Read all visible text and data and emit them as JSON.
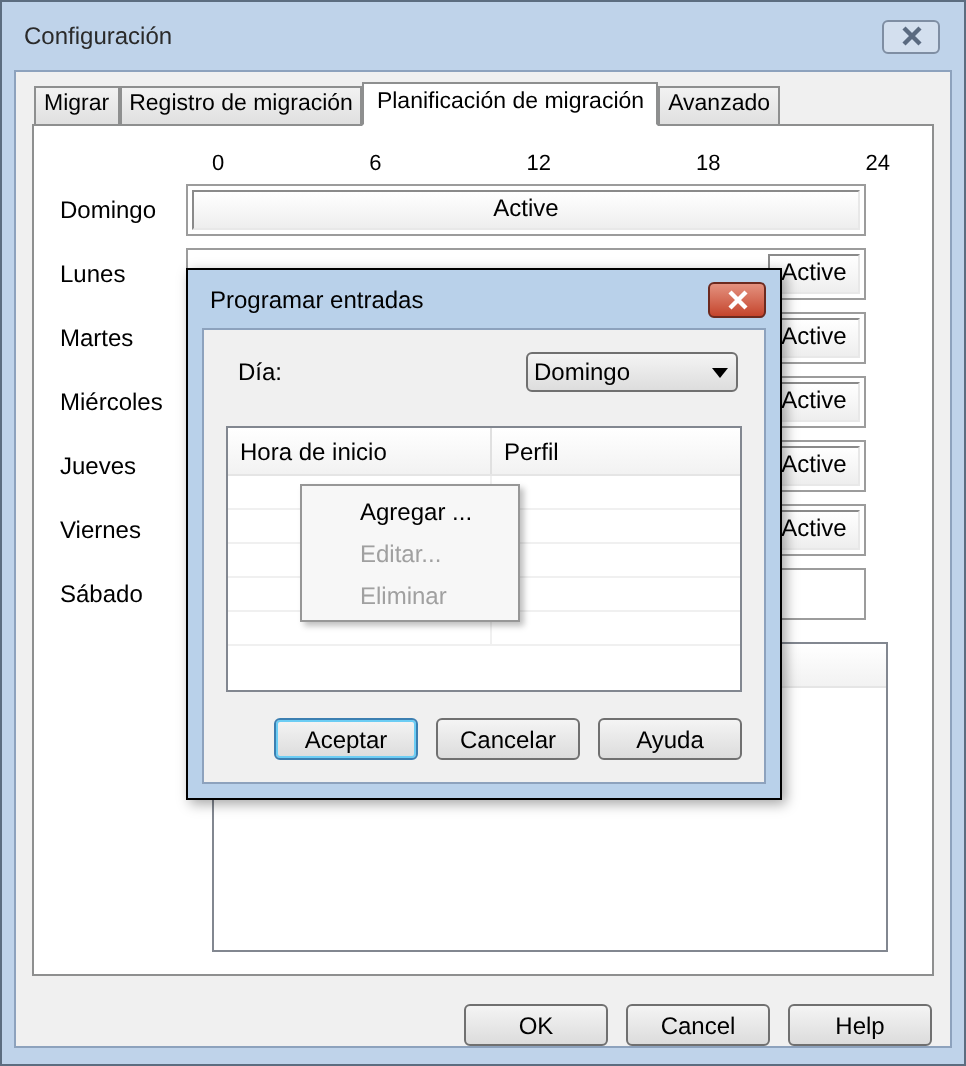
{
  "window": {
    "title": "Configuración"
  },
  "tabs": [
    {
      "label": "Migrar",
      "selected": false
    },
    {
      "label": "Registro de migración",
      "selected": false
    },
    {
      "label": "Planificación de migración",
      "selected": true
    },
    {
      "label": "Avanzado",
      "selected": false
    }
  ],
  "schedule": {
    "hour_ticks": [
      "0",
      "6",
      "12",
      "18",
      "24"
    ],
    "days": [
      {
        "name": "Domingo",
        "kind": "full",
        "segments": [
          "Active"
        ]
      },
      {
        "name": "Lunes",
        "kind": "tail",
        "segments": [
          "Active"
        ]
      },
      {
        "name": "Martes",
        "kind": "tail",
        "segments": [
          "Active"
        ]
      },
      {
        "name": "Miércoles",
        "kind": "tail",
        "segments": [
          "Active"
        ]
      },
      {
        "name": "Jueves",
        "kind": "tail",
        "segments": [
          "Active"
        ]
      },
      {
        "name": "Viernes",
        "kind": "tail",
        "segments": [
          "Active"
        ]
      },
      {
        "name": "Sábado",
        "kind": "tail"
      }
    ]
  },
  "buttons": [
    "OK",
    "Cancel",
    "Help"
  ],
  "dialog": {
    "title": "Programar entradas",
    "day_label": "Día:",
    "day_value": "Domingo",
    "columns": [
      "Hora de inicio",
      "Perfil"
    ],
    "context_menu": [
      {
        "label": "Agregar ...",
        "disabled": false
      },
      {
        "label": "Editar...",
        "disabled": true
      },
      {
        "label": "Eliminar",
        "disabled": true
      }
    ],
    "buttons": [
      {
        "label": "Aceptar",
        "default": true
      },
      {
        "label": "Cancelar",
        "default": false
      },
      {
        "label": "Ayuda",
        "default": false
      }
    ]
  }
}
